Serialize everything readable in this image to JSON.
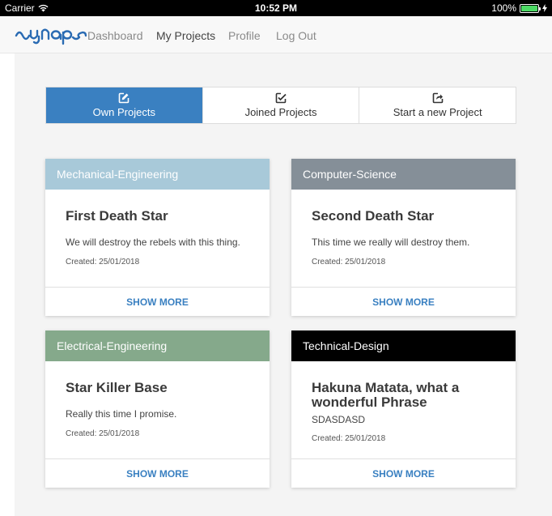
{
  "status_bar": {
    "carrier": "Carrier",
    "time": "10:52 PM",
    "battery": "100%"
  },
  "nav": {
    "logo_text": "synaps",
    "links": [
      "Dashboard",
      "My Projects",
      "Profile",
      "Log Out"
    ],
    "active": "My Projects"
  },
  "tabs": [
    {
      "label": "Own Projects",
      "icon": "edit-icon",
      "active": true
    },
    {
      "label": "Joined Projects",
      "icon": "check-edit-icon",
      "active": false
    },
    {
      "label": "Start a new Project",
      "icon": "share-icon",
      "active": false
    }
  ],
  "projects": [
    {
      "category": "Mechanical-Engineering",
      "category_color": "#a8c9d9",
      "title": "First Death Star",
      "description": "We will destroy the rebels with this thing.",
      "created": "Created: 25/01/2018",
      "action": "SHOW MORE"
    },
    {
      "category": "Computer-Science",
      "category_color": "#858f98",
      "title": "Second Death Star",
      "description": "This time we really will destroy them.",
      "created": "Created: 25/01/2018",
      "action": "SHOW MORE"
    },
    {
      "category": "Electrical-Engineering",
      "category_color": "#85a98b",
      "title": "Star Killer Base",
      "description": "Really this time I promise.",
      "created": "Created: 25/01/2018",
      "action": "SHOW MORE"
    },
    {
      "category": "Technical-Design",
      "category_color": "#000000",
      "title": "Hakuna Matata, what a wonderful Phrase",
      "description": "SDASDASD",
      "created": "Created: 25/01/2018",
      "action": "SHOW MORE"
    }
  ],
  "colors": {
    "accent": "#3a80c1",
    "brand": "#2a6bb3"
  }
}
